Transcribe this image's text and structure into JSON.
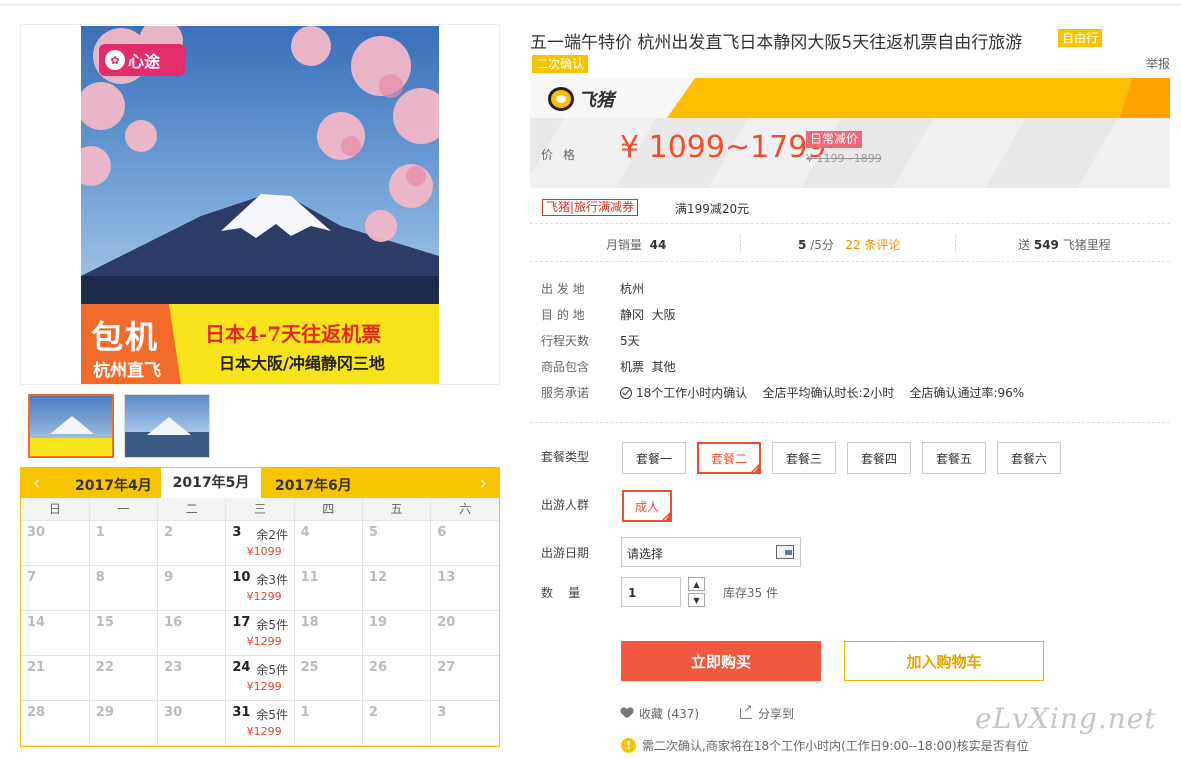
{
  "product": {
    "title": "五一端午特价 杭州出发直飞日本静冈大阪5天往返机票自由行旅游",
    "tag_self": "自由行",
    "tag_confirm": "二次确认",
    "report": "举报"
  },
  "image": {
    "logo_text": "心途",
    "banner_big": "包机",
    "banner_small": "杭州直飞",
    "banner_line1": "日本4-7天往返机票",
    "banner_line2": "日本大阪/冲绳静冈三地"
  },
  "brand": {
    "name": "飞猪"
  },
  "price": {
    "label": "价格",
    "main": "¥ 1099~1799",
    "badge": "日常减价",
    "original": "¥ 1199~1899"
  },
  "coupon": {
    "tag": "飞猪|旅行满减券",
    "text": "满199减20元"
  },
  "stats": {
    "monthly_label": "月销量",
    "monthly_value": "44",
    "score": "5",
    "score_unit": "/5分",
    "reviews": "22 条评论",
    "miles_prefix": "送",
    "miles_value": "549",
    "miles_suffix": "飞猪里程"
  },
  "info": [
    {
      "label": "出 发 地",
      "value": "杭州"
    },
    {
      "label": "目 的 地",
      "value": "静冈  大阪"
    },
    {
      "label": "行程天数",
      "value": "5天"
    },
    {
      "label": "商品包含",
      "value": "机票  其他"
    },
    {
      "label": "服务承诺",
      "value": "18个工作小时内确认    全店平均确认时长:2小时    全店确认通过率:96%"
    }
  ],
  "options": {
    "package_label": "套餐类型",
    "packages": [
      "套餐一",
      "套餐二",
      "套餐三",
      "套餐四",
      "套餐五",
      "套餐六"
    ],
    "selected_package": 1,
    "group_label": "出游人群",
    "group_value": "成人",
    "date_label": "出游日期",
    "date_placeholder": "请选择",
    "qty_label": "数    量",
    "qty_value": "1",
    "stock": "库存35 件"
  },
  "actions": {
    "buy": "立即购买",
    "cart": "加入购物车",
    "fav": "收藏 (437)",
    "share": "分享到",
    "notice": "需二次确认,商家将在18个工作小时内(工作日9:00--18:00)核实是否有位"
  },
  "calendar": {
    "prev": "‹",
    "next": "›",
    "months": [
      "2017年4月",
      "2017年5月",
      "2017年6月"
    ],
    "weekdays": [
      "日",
      "一",
      "二",
      "三",
      "四",
      "五",
      "六"
    ],
    "weeks": [
      [
        {
          "d": "30"
        },
        {
          "d": "1"
        },
        {
          "d": "2"
        },
        {
          "d": "3",
          "stock": "余2件",
          "price": "¥1099"
        },
        {
          "d": "4"
        },
        {
          "d": "5"
        },
        {
          "d": "6"
        }
      ],
      [
        {
          "d": "7"
        },
        {
          "d": "8"
        },
        {
          "d": "9"
        },
        {
          "d": "10",
          "stock": "余3件",
          "price": "¥1299"
        },
        {
          "d": "11"
        },
        {
          "d": "12"
        },
        {
          "d": "13"
        }
      ],
      [
        {
          "d": "14"
        },
        {
          "d": "15"
        },
        {
          "d": "16"
        },
        {
          "d": "17",
          "stock": "余5件",
          "price": "¥1299"
        },
        {
          "d": "18"
        },
        {
          "d": "19"
        },
        {
          "d": "20"
        }
      ],
      [
        {
          "d": "21"
        },
        {
          "d": "22"
        },
        {
          "d": "23"
        },
        {
          "d": "24",
          "stock": "余5件",
          "price": "¥1299"
        },
        {
          "d": "25"
        },
        {
          "d": "26"
        },
        {
          "d": "27"
        }
      ],
      [
        {
          "d": "28"
        },
        {
          "d": "29"
        },
        {
          "d": "30"
        },
        {
          "d": "31",
          "stock": "余5件",
          "price": "¥1299"
        },
        {
          "d": "1"
        },
        {
          "d": "2"
        },
        {
          "d": "3"
        }
      ]
    ]
  },
  "watermark": "eLvXing.net",
  "colors": {
    "accent": "#f24e2b",
    "brand_yellow": "#fdbd00",
    "calendar_yellow": "#f7c400"
  }
}
